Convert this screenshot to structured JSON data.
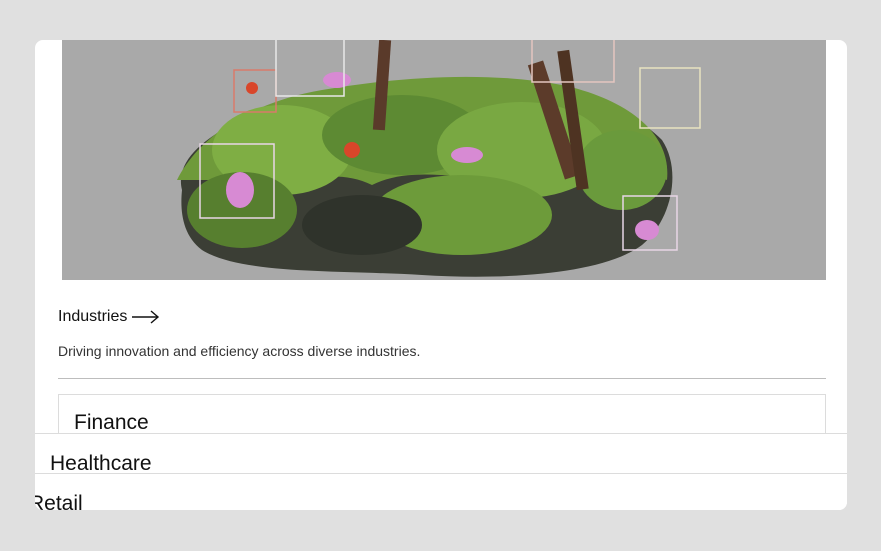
{
  "industries": {
    "heading": "Industries",
    "arrow_icon": "arrow-right-icon",
    "description": "Driving innovation and efficiency across diverse industries.",
    "items": [
      {
        "label": "Finance"
      },
      {
        "label": "Healthcare"
      },
      {
        "label": "Retail"
      }
    ]
  },
  "colors": {
    "page_background": "#e0e0e0",
    "card_background": "#ffffff",
    "hero_background": "#a9a9a9",
    "moss": "#6f9a3a",
    "rock": "#3b3e35",
    "flower_pink": "#d78ad3",
    "flower_red": "#d9462a"
  }
}
